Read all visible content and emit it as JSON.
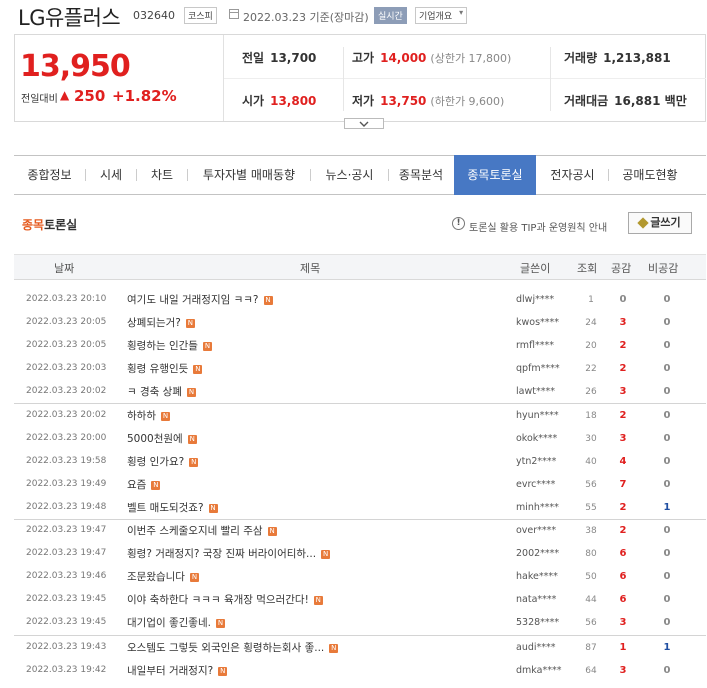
{
  "header": {
    "company": "LG유플러스",
    "code": "032640",
    "market": "코스피",
    "date_text": "2022.03.23 기준(장마감)",
    "realtime": "실시간",
    "corp_info": "기업개요",
    "corp_info_arrow": "▾"
  },
  "price": {
    "current": "13,950",
    "change_label": "전일대비",
    "change_dir": "▲",
    "change_value": "250",
    "change_pct": "+1.82%",
    "prev_close_label": "전일",
    "prev_close": "13,700",
    "high_label": "고가",
    "high": "14,000",
    "upper_limit": "(상한가 17,800)",
    "volume_label": "거래량",
    "volume": "1,213,881",
    "open_label": "시가",
    "open": "13,800",
    "low_label": "저가",
    "low": "13,750",
    "lower_limit": "(하한가 9,600)",
    "amount_label": "거래대금",
    "amount": "16,881 백만"
  },
  "tabs": [
    {
      "label": "종합정보"
    },
    {
      "label": "시세"
    },
    {
      "label": "차트"
    },
    {
      "label": "투자자별 매매동향"
    },
    {
      "label": "뉴스·공시"
    },
    {
      "label": "종목분석"
    },
    {
      "label": "종목토론실"
    },
    {
      "label": "전자공시"
    },
    {
      "label": "공매도현황"
    }
  ],
  "board": {
    "title_hl": "종목",
    "title_rest": "토론실",
    "tip_icon": "!",
    "tip_text": "토론실 활용 TIP과 운영원칙 안내",
    "write_label": "글쓰기",
    "new_badge": "N",
    "columns": {
      "date": "날짜",
      "title": "제목",
      "author": "글쓴이",
      "views": "조회",
      "up": "공감",
      "down": "비공감"
    },
    "posts": [
      {
        "date": "2022.03.23 20:10",
        "title": "여기도 내일 거래정지임 ㅋㅋ?",
        "author": "dlwj****",
        "views": "1",
        "up": "0",
        "down": "0"
      },
      {
        "date": "2022.03.23 20:05",
        "title": "상폐되는거?",
        "author": "kwos****",
        "views": "24",
        "up": "3",
        "down": "0"
      },
      {
        "date": "2022.03.23 20:05",
        "title": "횡령하는 인간들",
        "author": "rmfl****",
        "views": "20",
        "up": "2",
        "down": "0"
      },
      {
        "date": "2022.03.23 20:03",
        "title": "횡령 유행인듯",
        "author": "qpfm****",
        "views": "22",
        "up": "2",
        "down": "0"
      },
      {
        "date": "2022.03.23 20:02",
        "title": "ㅋ 경축 상폐",
        "author": "lawt****",
        "views": "26",
        "up": "3",
        "down": "0"
      },
      {
        "date": "2022.03.23 20:02",
        "title": "하하하",
        "author": "hyun****",
        "views": "18",
        "up": "2",
        "down": "0"
      },
      {
        "date": "2022.03.23 20:00",
        "title": "5000천원에",
        "author": "okok****",
        "views": "30",
        "up": "3",
        "down": "0"
      },
      {
        "date": "2022.03.23 19:58",
        "title": "횡령 인가요?",
        "author": "ytn2****",
        "views": "40",
        "up": "4",
        "down": "0"
      },
      {
        "date": "2022.03.23 19:49",
        "title": "요즘",
        "author": "evrc****",
        "views": "56",
        "up": "7",
        "down": "0"
      },
      {
        "date": "2022.03.23 19:48",
        "title": "벨트 매도되것죠?",
        "author": "minh****",
        "views": "55",
        "up": "2",
        "down": "1"
      },
      {
        "date": "2022.03.23 19:47",
        "title": "이번주 스케줄오지네 빨리 주삼",
        "author": "over****",
        "views": "38",
        "up": "2",
        "down": "0"
      },
      {
        "date": "2022.03.23 19:47",
        "title": "횡령? 거래정지? 국장 진짜 버라이어티하...",
        "author": "2002****",
        "views": "80",
        "up": "6",
        "down": "0"
      },
      {
        "date": "2022.03.23 19:46",
        "title": "조문왔습니다",
        "author": "hake****",
        "views": "50",
        "up": "6",
        "down": "0"
      },
      {
        "date": "2022.03.23 19:45",
        "title": "이야 축하한다 ㅋㅋㅋ 육개장 먹으러간다!",
        "author": "nata****",
        "views": "44",
        "up": "6",
        "down": "0"
      },
      {
        "date": "2022.03.23 19:45",
        "title": "대기업이 좋긴좋네.",
        "author": "5328****",
        "views": "56",
        "up": "3",
        "down": "0"
      },
      {
        "date": "2022.03.23 19:43",
        "title": "오스템도 그렇듯 외국인은 횡령하는회사 좋...",
        "author": "audi****",
        "views": "87",
        "up": "1",
        "down": "1"
      },
      {
        "date": "2022.03.23 19:42",
        "title": "내일부터 거래정지?",
        "author": "dmka****",
        "views": "64",
        "up": "3",
        "down": "0"
      }
    ]
  },
  "colors": {
    "up_red": "#e0201f",
    "down_blue": "#1f4ea1",
    "tab_active": "#4778c4",
    "accent_orange": "#e55a1e"
  }
}
